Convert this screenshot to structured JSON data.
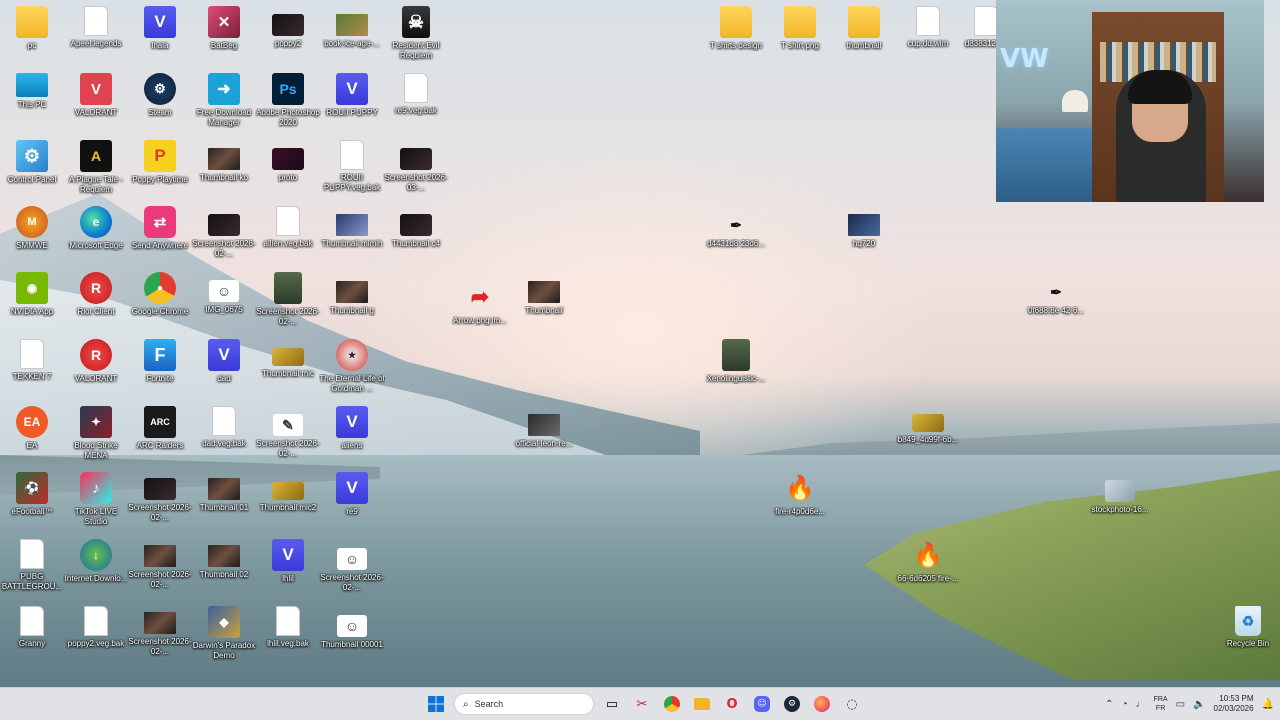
{
  "desktop_icons_col1": [
    "pc",
    "This PC",
    "Control Panel",
    "SMMWE",
    "NVIDIA App",
    "TEKKEN 7",
    "EA",
    "eFootball™",
    "PUBG BATTLEGROU...",
    "Granny"
  ],
  "desktop_icons_col2": [
    "Apeel.legends",
    "VALORANT",
    "A Plague Tale - Requiem",
    "Microsoft Edge",
    "Riot Client",
    "VALORANT",
    "Blood Strike MENA",
    "TikTok LIVE Studio",
    "Internet Downlo...",
    "poppy2.veg.bak"
  ],
  "desktop_icons_col3": [
    "lhala",
    "Steam",
    "Poppy Playtime",
    "Send Anywhere",
    "Google Chrome",
    "Fortnite",
    "ARC Raiders",
    "Screenshot 2026-02-...",
    "Screenshot 2026-02-...",
    "Screenshot 2026-02-..."
  ],
  "desktop_icons_col4": [
    "BatBeg",
    "Free Download Manager",
    "Thumbnail ko",
    "Screenshot 2026-02-...",
    "IMG_0675",
    "dad",
    "dad.veg.bak",
    "Thumbnail 01",
    "Thumbnail 02",
    "Darwin's Paradox Demo"
  ],
  "desktop_icons_col5": [
    "poppy2",
    "Adobe Photoshop 2020",
    "proto",
    "allien.veg.bak",
    "Screenshot 2026-02-...",
    "Thumbnail mic",
    "Screenshot 2026-02-...",
    "Thumbnail mic2",
    "lhlil",
    "lhlil.veg.bak"
  ],
  "desktop_icons_col6": [
    "book-ice-age-...",
    "ROUII PUPPY",
    "ROUII PUPPY.veg.bak",
    "Thumbnail mimih",
    "Thumbnail g",
    "The Eternal Life of Goldman ...",
    "aliens",
    "re9",
    "Screenshot 2026-02-...",
    "Thumbnail 00001"
  ],
  "desktop_icons_col7": [
    "Resident Evil Requiem",
    "re9.veg.bak",
    "Screenshot 2026-03-...",
    "Thumbnail c4"
  ],
  "desktop_icons_scattered": {
    "arrow": "Arrow png im...",
    "thumbnail": "Thumbnail",
    "official": "official-leon-re...",
    "xenolinguistic": "Xenolinguistic-...",
    "d4": "d4431d8 23d6...",
    "hq720": "hq720",
    "b849": "b849_4d99f-6b...",
    "fire1": "fire-r4p0d6e...",
    "stockphoto": "stockphoto-16...",
    "fire2": "66-6d6205 fire-...",
    "tshirt_design": "T shirts design",
    "tshirt_png": "T shirt png",
    "thumbnail_folder": "thumbnail",
    "cup": "cup.dd.wim",
    "d8": "d8383123...",
    "f3": "0f688.8e 42-6...",
    "recycle": "Recycle Bin"
  },
  "taskbar": {
    "search_placeholder": "Search",
    "lang_top": "FRA",
    "lang_bottom": "FR",
    "time": "10:53 PM",
    "date": "02/03/2026"
  },
  "icon_semantics": {
    "start": "windows-start-icon",
    "search": "search-icon",
    "task_view": "task-view-icon",
    "snip": "snipping-tool-icon",
    "chrome": "chrome-icon",
    "explorer": "file-explorer-icon",
    "opera": "opera-gx-icon",
    "discord": "discord-icon",
    "steam": "steam-icon",
    "firefox": "firefox-icon",
    "chevron": "chevron-up-icon",
    "network": "wifi-icon",
    "mic": "microphone-icon",
    "speaker": "speaker-icon",
    "notification": "bell-icon"
  }
}
